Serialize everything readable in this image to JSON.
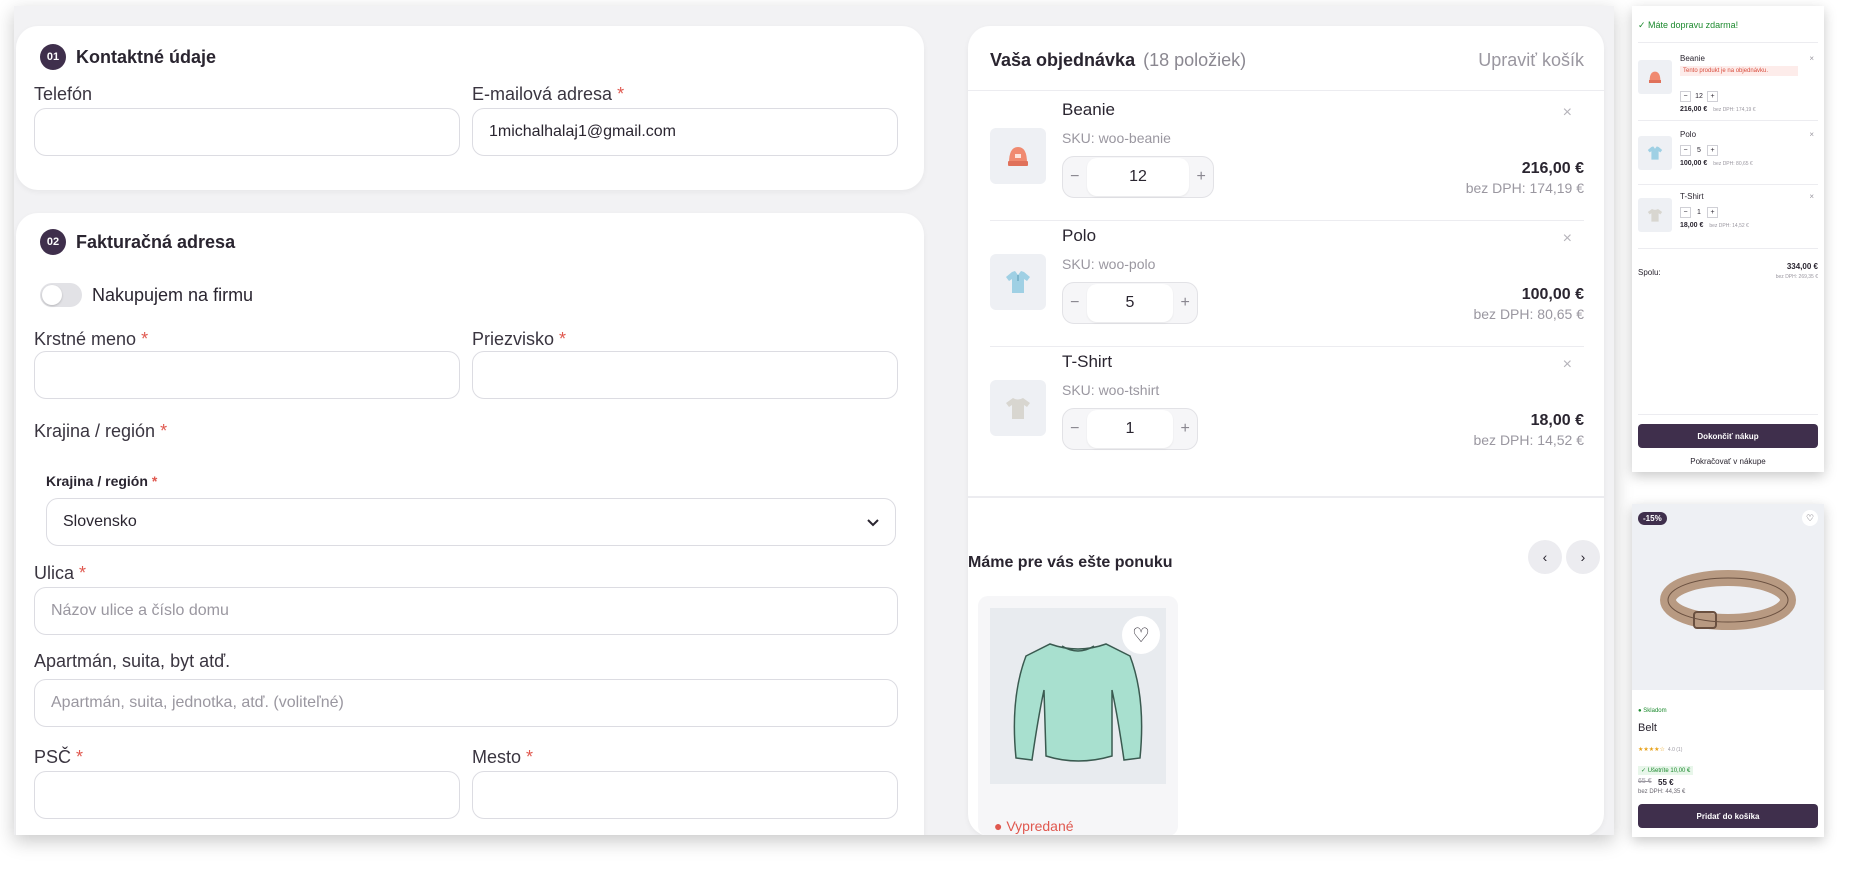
{
  "contact": {
    "step": "01",
    "title": "Kontaktné údaje",
    "phone_label": "Telefón",
    "phone_value": "",
    "email_label": "E-mailová adresa",
    "email_value": "1michalhalaj1@gmail.com",
    "required_mark": "*"
  },
  "billing": {
    "step": "02",
    "title": "Fakturačná adresa",
    "company_toggle": "Nakupujem na firmu",
    "first_name_label": "Krstné meno",
    "last_name_label": "Priezvisko",
    "country_label": "Krajina / región",
    "country_sub_label": "Krajina / región",
    "country_value": "Slovensko",
    "street_label": "Ulica",
    "street_placeholder": "Názov ulice a číslo domu",
    "apartment_label": "Apartmán, suita, byt atď.",
    "apartment_placeholder": "Apartmán, suita, jednotka, atď. (voliteľné)",
    "zip_label": "PSČ",
    "city_label": "Mesto",
    "required_mark": "*"
  },
  "order": {
    "title": "Vaša objednávka",
    "count": "(18 položiek)",
    "edit_label": "Upraviť košík",
    "items": [
      {
        "name": "Beanie",
        "sku": "SKU: woo-beanie",
        "qty": "12",
        "price": "216,00 €",
        "net": "bez DPH: 174,19 €",
        "icon": "beanie-icon"
      },
      {
        "name": "Polo",
        "sku": "SKU: woo-polo",
        "qty": "5",
        "price": "100,00 €",
        "net": "bez DPH: 80,65 €",
        "icon": "polo-shirt-icon"
      },
      {
        "name": "T-Shirt",
        "sku": "SKU: woo-tshirt",
        "qty": "1",
        "price": "18,00 €",
        "net": "bez DPH: 14,52 €",
        "icon": "tshirt-icon"
      }
    ],
    "remove_glyph": "×",
    "minus_glyph": "−",
    "plus_glyph": "+"
  },
  "offer": {
    "title": "Máme pre vás ešte ponuku",
    "prev_glyph": "‹",
    "next_glyph": "›",
    "heart_glyph": "♡",
    "status": "● Vypredané"
  },
  "mini_cart": {
    "shipping": "✓ Máte dopravu zdarma!",
    "items": [
      {
        "name": "Beanie",
        "qty": "12",
        "price": "216,00 €",
        "net": "bez DPH: 174,19 €",
        "warning": "Tento produkt je na objednávku."
      },
      {
        "name": "Polo",
        "qty": "5",
        "price": "100,00 €",
        "net": "bez DPH: 80,65 €"
      },
      {
        "name": "T-Shirt",
        "qty": "1",
        "price": "18,00 €",
        "net": "bez DPH: 14,52 €"
      }
    ],
    "total_label": "Spolu:",
    "total": "334,00 €",
    "total_net": "bez DPH: 269,35 €",
    "checkout": "Dokončiť nákup",
    "continue": "Pokračovať v nákupe",
    "remove_glyph": "×"
  },
  "product": {
    "badge": "-15%",
    "stock": "● Skladom",
    "name": "Belt",
    "stars": "★★★★☆",
    "rating": "4.0 (1)",
    "save": "✓ Ušetríte 10,00 €",
    "old_price": "65 €",
    "new_price": "55 €",
    "net_price": "bez DPH: 44,35 €",
    "add_to_cart": "Pridať do košíka",
    "heart_glyph": "♡"
  },
  "colors": {
    "accent": "#3f2f4c",
    "required": "#e0584f",
    "success": "#1c8a2e"
  }
}
